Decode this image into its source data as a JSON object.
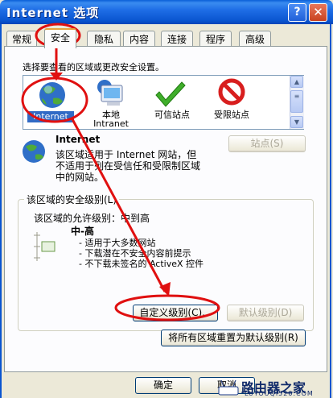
{
  "window": {
    "title": "Internet 选项",
    "help": "?",
    "close": "✕"
  },
  "tabs": [
    {
      "label": "常规"
    },
    {
      "label": "安全"
    },
    {
      "label": "隐私"
    },
    {
      "label": "内容"
    },
    {
      "label": "连接"
    },
    {
      "label": "程序"
    },
    {
      "label": "高级"
    }
  ],
  "security": {
    "instruction": "选择要查看的区域或更改安全设置。",
    "zones": [
      {
        "label": "Internet",
        "icon": "globe-icon"
      },
      {
        "label": "本地",
        "label2": "Intranet",
        "icon": "intranet-computer-icon"
      },
      {
        "label": "可信站点",
        "icon": "checkmark-icon"
      },
      {
        "label": "受限站点",
        "icon": "no-entry-icon"
      }
    ],
    "zone_title": "Internet",
    "zone_desc": [
      "该区域适用于 Internet 网站，但",
      "不适用于列在受信任和受限制区域",
      "中的网站。"
    ],
    "sites_button": "站点(S)",
    "level_group": "该区域的安全级别(L)",
    "allowed_level": "该区域的允许级别：中到高",
    "level_name": "中-高",
    "level_bullets": [
      "- 适用于大多数网站",
      "- 下载潜在不安全内容前提示",
      "- 不下载未签名的 ActiveX 控件"
    ],
    "custom_button": "自定义级别(C)...",
    "default_button": "默认级别(D)",
    "reset_all_button": "将所有区域重置为默认级别(R)"
  },
  "footer": {
    "ok": "确定",
    "cancel": "取消"
  },
  "watermark": {
    "line1": "路由器之家",
    "line2": "LUYOUQI520.COM"
  },
  "colors": {
    "titlebar": "#0a55d0",
    "annotation": "#e01010"
  }
}
